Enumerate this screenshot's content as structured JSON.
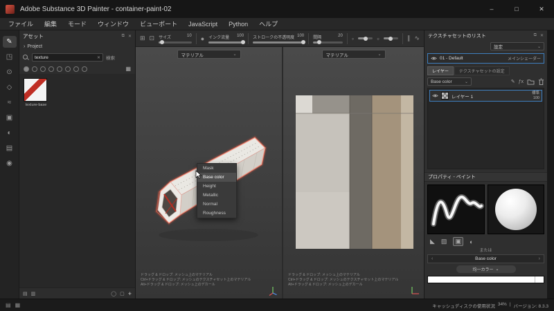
{
  "titlebar": {
    "title": "Adobe Substance 3D Painter - container-paint-02",
    "minimize": "–",
    "maximize": "□",
    "close": "✕"
  },
  "menubar": {
    "items": [
      "ファイル",
      "編集",
      "モード",
      "ウィンドウ",
      "ビューポート",
      "JavaScript",
      "Python",
      "ヘルプ"
    ]
  },
  "toolbar": {
    "groups": [
      {
        "label": "サイズ",
        "value": "10"
      },
      {
        "label": "インク流量",
        "value": "100"
      },
      {
        "label": "ストロークの不透明度",
        "value": "100"
      },
      {
        "label": "間隔",
        "value": "20"
      }
    ]
  },
  "rail": [
    {
      "name": "paint",
      "glyph": "✎"
    },
    {
      "name": "eraser",
      "glyph": "◳"
    },
    {
      "name": "projection",
      "glyph": "⊙"
    },
    {
      "name": "polygon-fill",
      "glyph": "◇"
    },
    {
      "name": "smudge",
      "glyph": "≈"
    },
    {
      "name": "clone",
      "glyph": "▣"
    },
    {
      "name": "material-picker",
      "glyph": "◐"
    },
    {
      "name": "geometry-mask",
      "glyph": "▤"
    },
    {
      "name": "particles",
      "glyph": "◉"
    }
  ],
  "assets": {
    "title": "アセット",
    "project": "Project",
    "chevron": "›",
    "search_value": "texture",
    "search_clear": "✕",
    "search_action": "検索",
    "grid_icon": "▦",
    "asset_name": "texture-base",
    "list_icon": "▤",
    "card_icon": "▥",
    "circle_icon": "◯",
    "frame_icon": "▢",
    "add": "+"
  },
  "viewport": {
    "material": "マテリアル",
    "dd_chevron": "⌄",
    "hints": [
      "ドラッグ & ドロップ:  メッシュ上のマテリアル",
      "Ctrl+ドラッグ & ドロップ:  メッシュのテクスチャセット上のマテリアル",
      "Alt+ドラッグ & ドロップ:  メッシュ上のデカール"
    ]
  },
  "context_menu": {
    "items": [
      "Mask",
      "Base color",
      "Height",
      "Metallic",
      "Normal",
      "Roughness"
    ]
  },
  "texture_set": {
    "title": "テクスチャセットのリスト",
    "dock_icon": "⧉",
    "close_icon": "✕",
    "settings": "設定",
    "name": "01 - Default",
    "shader": "メインシェーダー"
  },
  "layers": {
    "tab_layers": "レイヤー",
    "tab_set_settings": "テクスチャセットの設定",
    "channel": "Base color",
    "paint_icon": "✎",
    "effect_icon": "ƒx",
    "layer_name": "レイヤー 1",
    "blend": "標準",
    "opacity": "100"
  },
  "properties": {
    "title": "プロパティ - ペイント",
    "or": "または",
    "channel_button": "Base color",
    "prev": "‹",
    "next": "›",
    "uniform_color": "均一カラー",
    "modes": [
      {
        "name": "brush-tip",
        "glyph": "◣"
      },
      {
        "name": "stencil",
        "glyph": "▨"
      },
      {
        "name": "stroke",
        "glyph": "▣"
      },
      {
        "name": "material",
        "glyph": "◐"
      }
    ]
  },
  "status": {
    "log_icon": "▤",
    "layout_icon": "▦",
    "cache_label": "キャッシュディスクの使用状況",
    "cache_value": "34%",
    "separator": "|",
    "version": "バージョン: 8.3.3"
  },
  "colors": {
    "accent": "#3f7fbf",
    "glow": "#ff5a40"
  }
}
